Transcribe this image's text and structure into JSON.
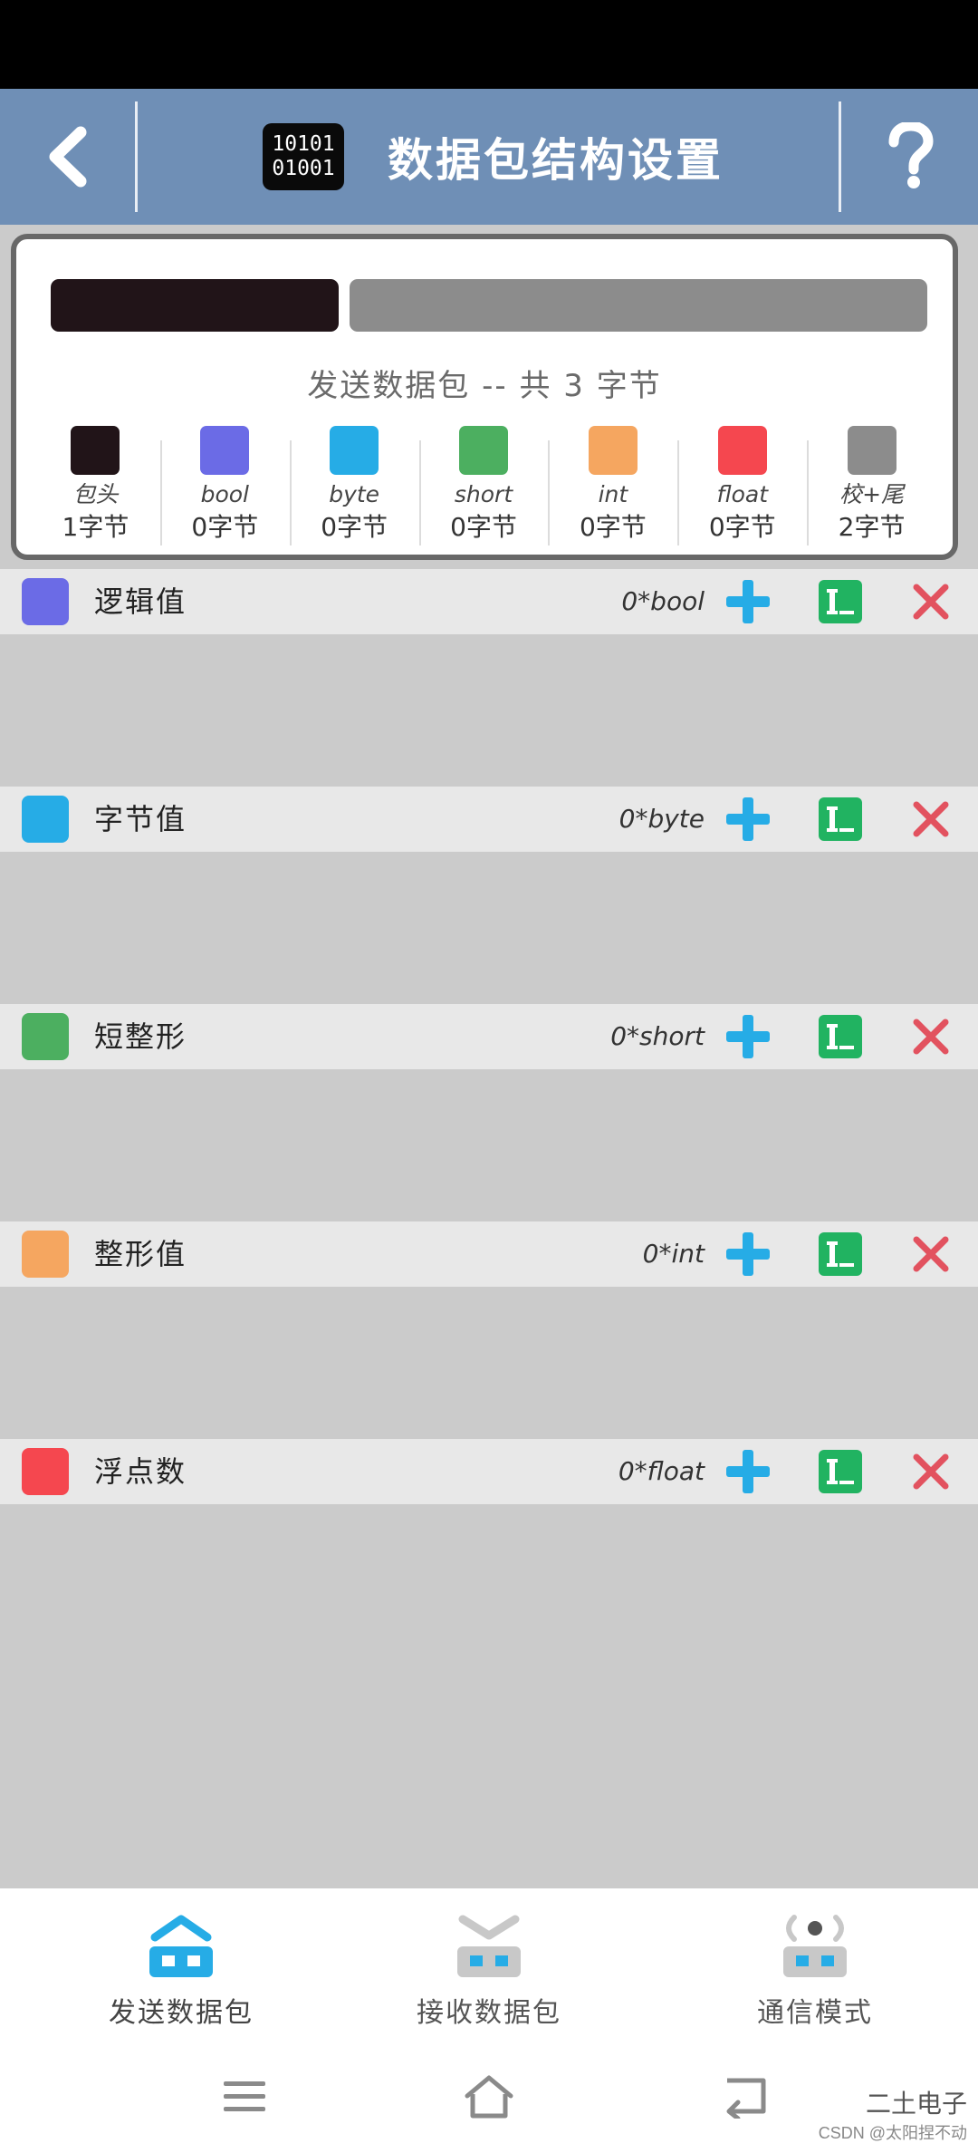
{
  "header": {
    "title": "数据包结构设置",
    "binary_line1": "10101",
    "binary_line2": "01001"
  },
  "summary": {
    "subtitle": "发送数据包 -- 共 3 字节",
    "types": [
      {
        "name": "包头",
        "bytes": "1字节",
        "color": "#211418"
      },
      {
        "name": "bool",
        "bytes": "0字节",
        "color": "#6b6be6"
      },
      {
        "name": "byte",
        "bytes": "0字节",
        "color": "#26ace6"
      },
      {
        "name": "short",
        "bytes": "0字节",
        "color": "#4caf60"
      },
      {
        "name": "int",
        "bytes": "0字节",
        "color": "#f5a660"
      },
      {
        "name": "float",
        "bytes": "0字节",
        "color": "#f5474f"
      },
      {
        "name": "校+尾",
        "bytes": "2字节",
        "color": "#8c8c8c"
      }
    ]
  },
  "rows": [
    {
      "label": "逻辑值",
      "count": "0*bool",
      "color": "#6b6be6"
    },
    {
      "label": "字节值",
      "count": "0*byte",
      "color": "#26ace6"
    },
    {
      "label": "短整形",
      "count": "0*short",
      "color": "#4caf60"
    },
    {
      "label": "整形值",
      "count": "0*int",
      "color": "#f5a660"
    },
    {
      "label": "浮点数",
      "count": "0*float",
      "color": "#f5474f"
    }
  ],
  "nav": [
    {
      "label": "发送数据包",
      "icon": "send-packet-icon"
    },
    {
      "label": "接收数据包",
      "icon": "receive-packet-icon"
    },
    {
      "label": "通信模式",
      "icon": "comm-mode-icon"
    }
  ],
  "watermark": {
    "top": "二土电子",
    "bottom": "CSDN @太阳捏不动"
  },
  "colors": {
    "header": "#6f8fb6",
    "accent_blue": "#26ace6",
    "edit_green": "#21b361",
    "delete_red": "#e2525f"
  }
}
